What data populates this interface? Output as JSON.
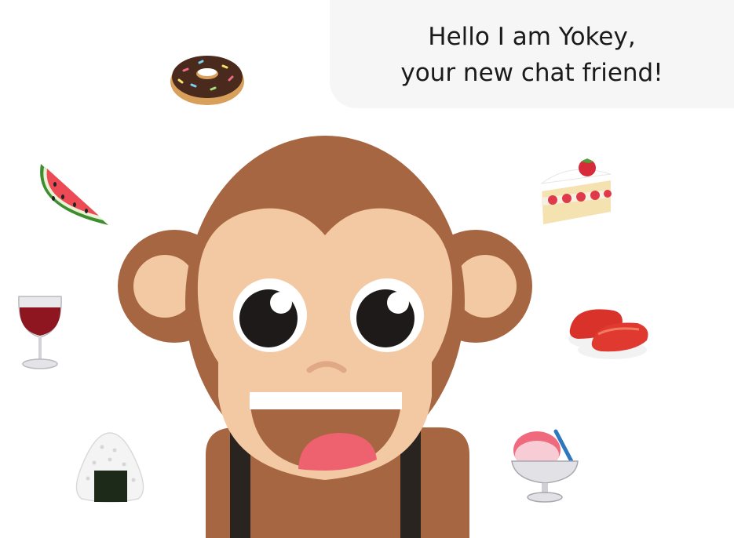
{
  "bubble": {
    "line1": "Hello I am Yokey,",
    "line2": "your new chat friend!"
  },
  "colors": {
    "fur": "#A66642",
    "skin": "#F3C9A3",
    "ear_inner": "#F3C9A3",
    "suspenders": "#2A2421",
    "mouth": "#A66642",
    "tongue": "#EE6270",
    "bubble_bg": "#F6F6F6"
  },
  "icons": [
    "donut-icon",
    "watermelon-icon",
    "wine-glass-icon",
    "rice-ball-icon",
    "shortcake-icon",
    "sushi-icon",
    "shaved-ice-icon"
  ]
}
